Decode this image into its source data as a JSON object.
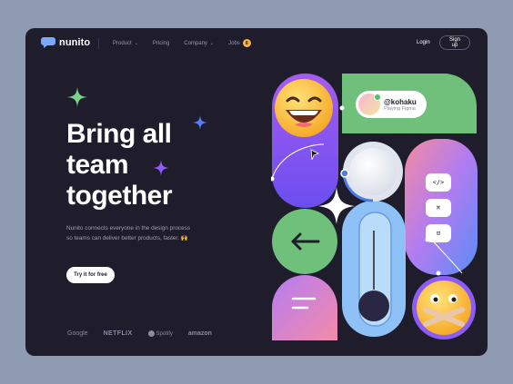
{
  "nav": {
    "logo": "nunito",
    "links": [
      "Product",
      "Pricing",
      "Company",
      "Jobs"
    ],
    "jobs_badge": "8",
    "login": "Login",
    "signup": "Sign up"
  },
  "hero": {
    "title_lines": [
      "Bring all",
      "team",
      "together"
    ],
    "description": "Nunito connects everyone in the design process so teams can deliver better products, faster. 🙌",
    "cta": "Try it for free"
  },
  "brands": [
    "Google",
    "NETFLIX",
    "Spotify",
    "amazon"
  ],
  "profile": {
    "handle": "@kohaku",
    "status": "Playing Figma"
  },
  "tools": {
    "code": "</>",
    "command": "⌘",
    "crop": "⊡"
  },
  "colors": {
    "background": "#1f1c2c",
    "accent_purple": "#8b5cf6",
    "accent_green": "#6ec07a",
    "accent_blue": "#7fb6f4",
    "badge": "#f4b63c"
  }
}
